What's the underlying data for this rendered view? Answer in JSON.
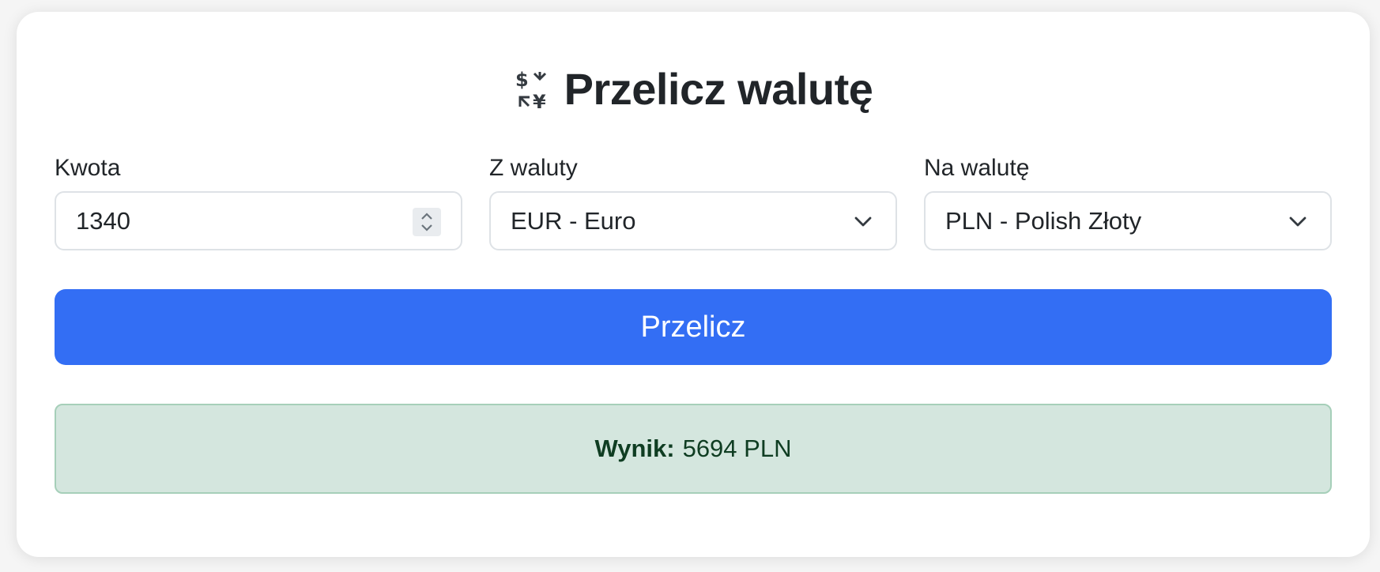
{
  "header": {
    "icon": "currency-exchange-icon",
    "title": "Przelicz walutę"
  },
  "form": {
    "amount": {
      "label": "Kwota",
      "value": "1340"
    },
    "from_currency": {
      "label": "Z waluty",
      "selected": "EUR - Euro"
    },
    "to_currency": {
      "label": "Na walutę",
      "selected": "PLN - Polish Złoty"
    },
    "submit_label": "Przelicz"
  },
  "result": {
    "label": "Wynik:",
    "value": "5694 PLN"
  },
  "colors": {
    "primary": "#336ef4",
    "result_bg": "#d4e6de",
    "result_border": "#a6cfb9",
    "result_text": "#0f3d22"
  }
}
